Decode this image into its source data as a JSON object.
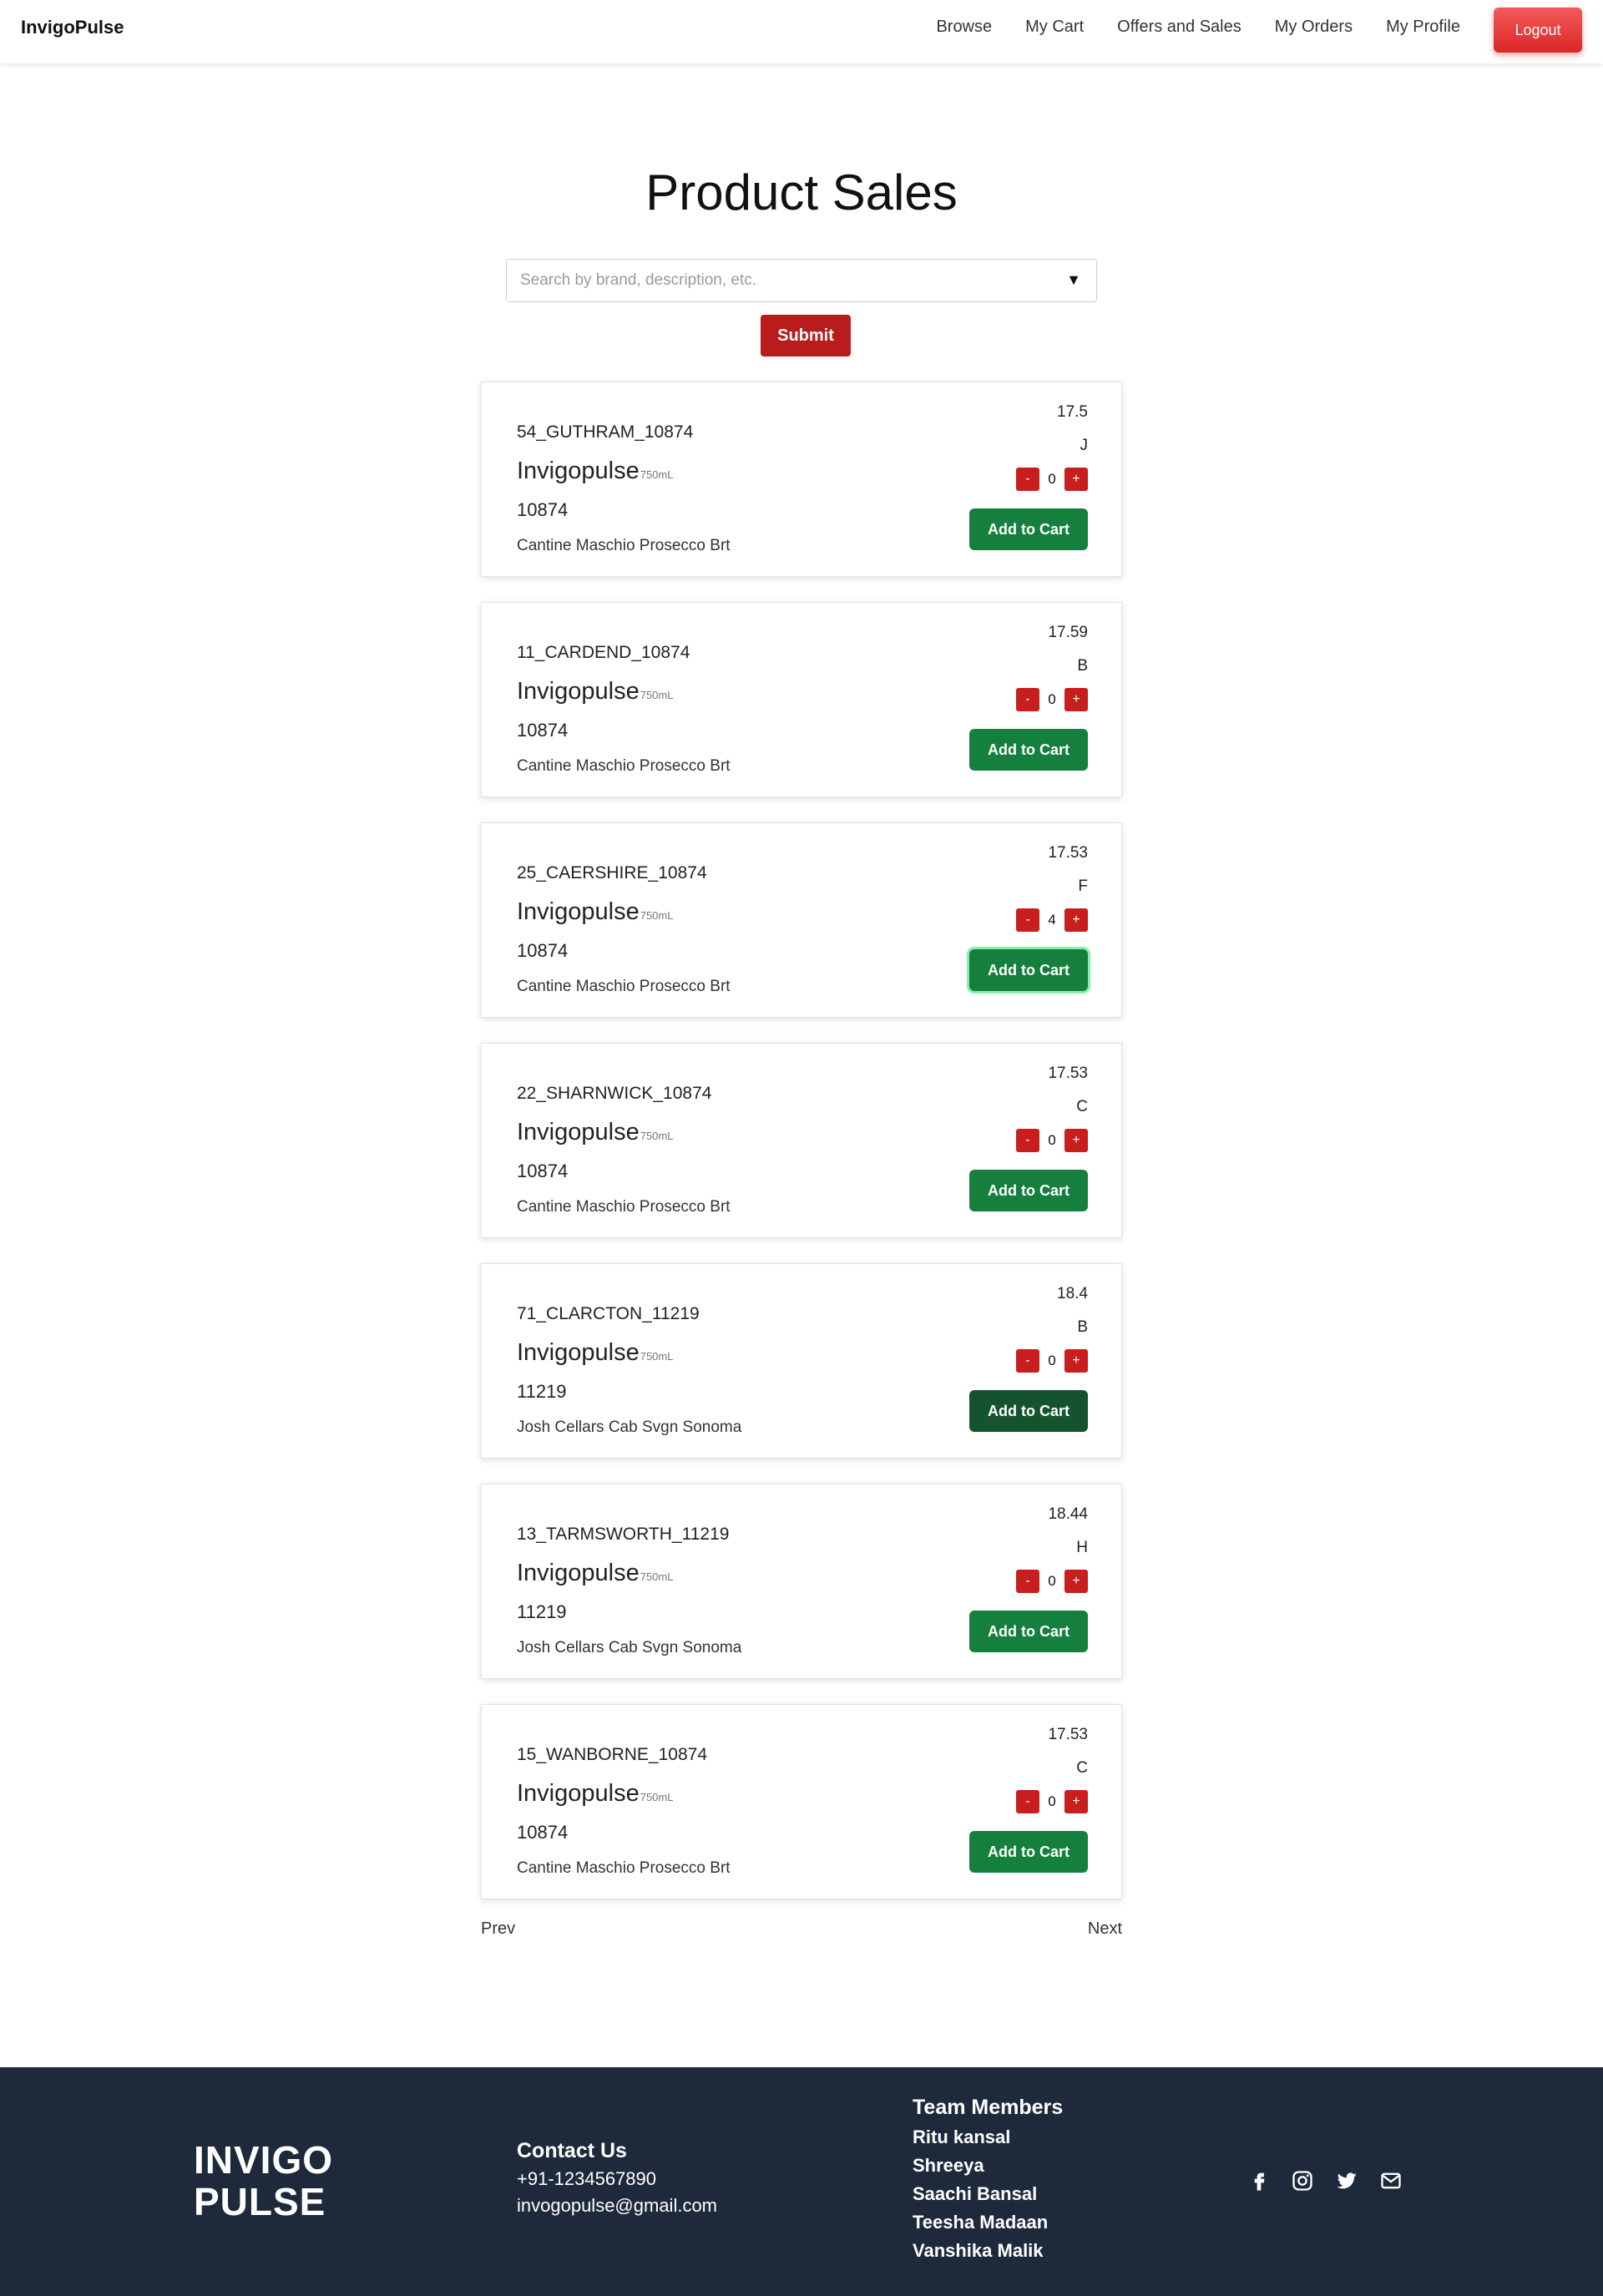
{
  "nav": {
    "brand": "InvigoPulse",
    "links": [
      "Browse",
      "My Cart",
      "Offers and Sales",
      "My Orders",
      "My Profile"
    ],
    "logout": "Logout"
  },
  "page": {
    "title": "Product Sales",
    "search_placeholder": "Search by brand, description, etc.",
    "submit": "Submit"
  },
  "products": [
    {
      "code": "54_GUTHRAM_10874",
      "brand": "Invigopulse",
      "size": "750mL",
      "number": "10874",
      "description": "Cantine Maschio Prosecco Brt",
      "price": "17.5",
      "grade": "J",
      "qty": "0",
      "add_label": "Add to Cart"
    },
    {
      "code": "11_CARDEND_10874",
      "brand": "Invigopulse",
      "size": "750mL",
      "number": "10874",
      "description": "Cantine Maschio Prosecco Brt",
      "price": "17.59",
      "grade": "B",
      "qty": "0",
      "add_label": "Add to Cart"
    },
    {
      "code": "25_CAERSHIRE_10874",
      "brand": "Invigopulse",
      "size": "750mL",
      "number": "10874",
      "description": "Cantine Maschio Prosecco Brt",
      "price": "17.53",
      "grade": "F",
      "qty": "4",
      "add_label": "Add to Cart"
    },
    {
      "code": "22_SHARNWICK_10874",
      "brand": "Invigopulse",
      "size": "750mL",
      "number": "10874",
      "description": "Cantine Maschio Prosecco Brt",
      "price": "17.53",
      "grade": "C",
      "qty": "0",
      "add_label": "Add to Cart"
    },
    {
      "code": "71_CLARCTON_11219",
      "brand": "Invigopulse",
      "size": "750mL",
      "number": "11219",
      "description": "Josh Cellars Cab Svgn Sonoma",
      "price": "18.4",
      "grade": "B",
      "qty": "0",
      "add_label": "Add to Cart"
    },
    {
      "code": "13_TARMSWORTH_11219",
      "brand": "Invigopulse",
      "size": "750mL",
      "number": "11219",
      "description": "Josh Cellars Cab Svgn Sonoma",
      "price": "18.44",
      "grade": "H",
      "qty": "0",
      "add_label": "Add to Cart"
    },
    {
      "code": "15_WANBORNE_10874",
      "brand": "Invigopulse",
      "size": "750mL",
      "number": "10874",
      "description": "Cantine Maschio Prosecco Brt",
      "price": "17.53",
      "grade": "C",
      "qty": "0",
      "add_label": "Add to Cart"
    }
  ],
  "qty_controls": {
    "minus": "-",
    "plus": "+"
  },
  "pagination": {
    "prev": "Prev",
    "next": "Next"
  },
  "footer": {
    "logo_line1": "INVIGO",
    "logo_line2": "PULSE",
    "contact_heading": "Contact Us",
    "phone": "+91-1234567890",
    "email": "invogopulse@gmail.com",
    "team_heading": "Team Members",
    "team": [
      "Ritu kansal",
      "Shreeya",
      "Saachi Bansal",
      "Teesha Madaan",
      "Vanshika Malik"
    ],
    "social_icons": [
      "facebook-icon",
      "instagram-icon",
      "twitter-icon",
      "mail-icon"
    ]
  },
  "colors": {
    "primary_red": "#b91c1c",
    "cart_green": "#15803d",
    "logout_gradient_top": "#f45a5a",
    "footer_bg": "#1e293b"
  }
}
